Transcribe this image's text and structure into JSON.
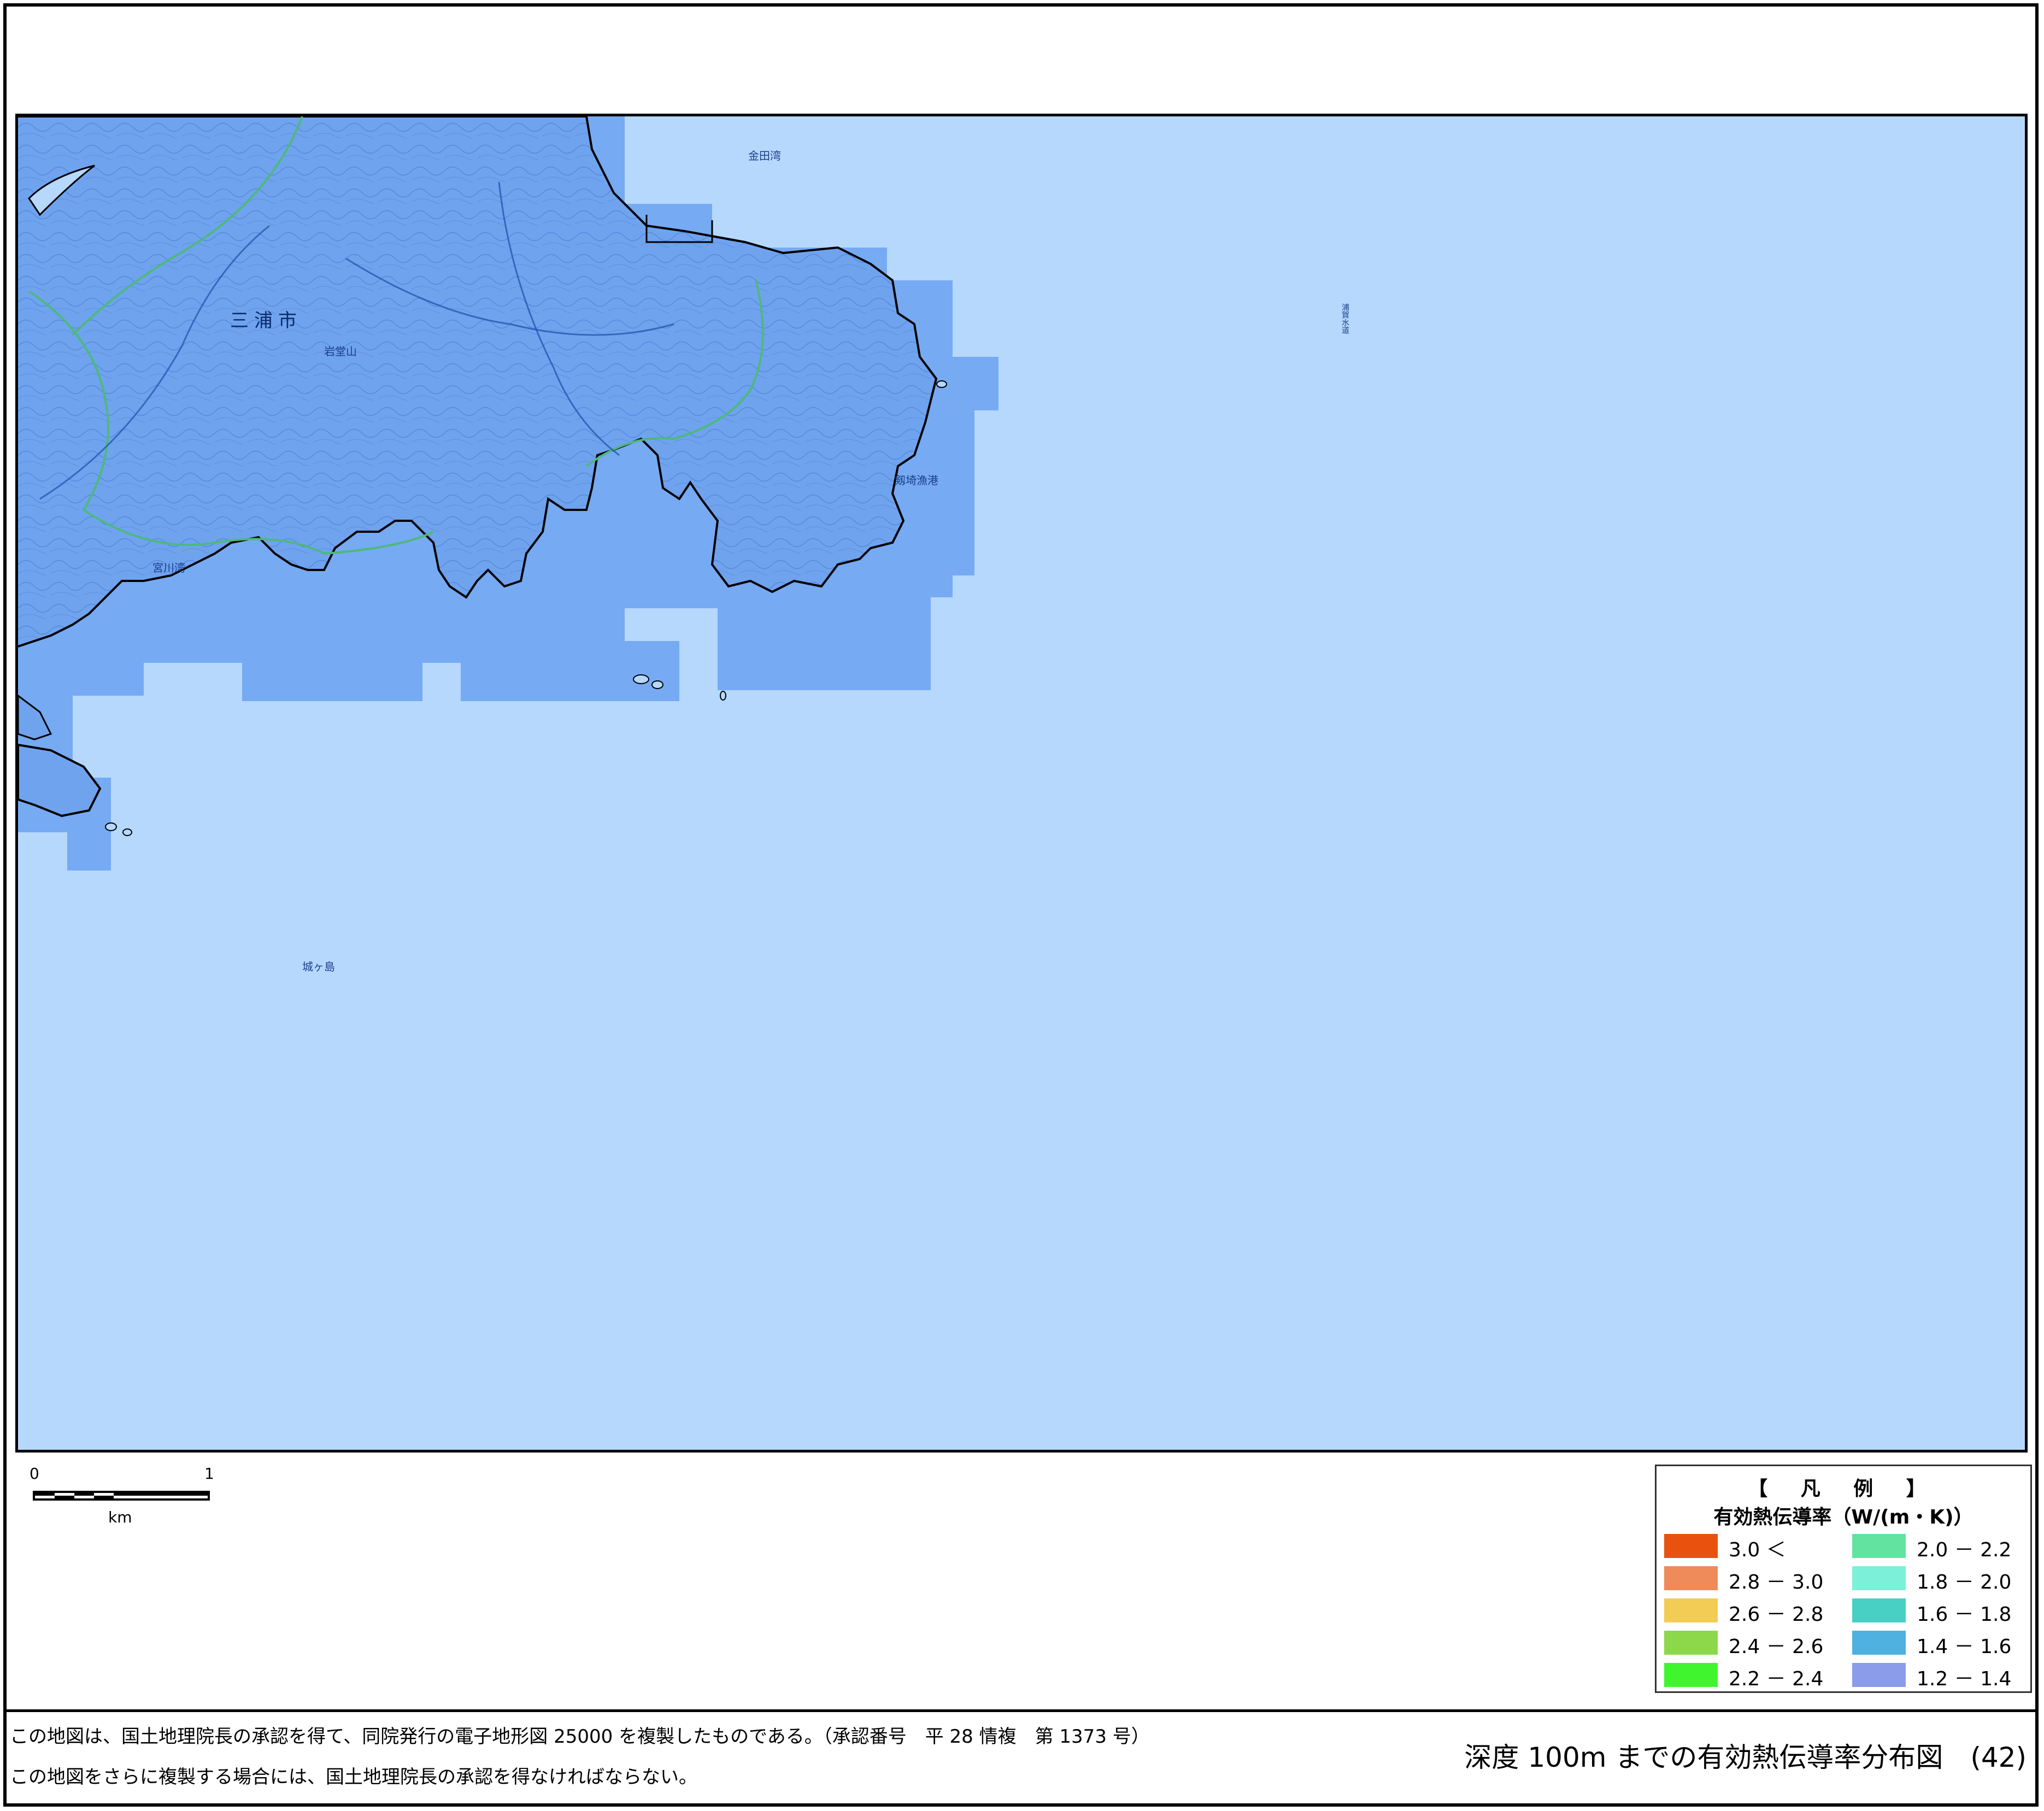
{
  "map": {
    "places": {
      "miura_city": "三浦市",
      "yamaname": "岩堂山",
      "kaneda_bay": "金田湾",
      "miyakawa_bay": "宮川湾",
      "suiro": "浦賀水道",
      "jogashima": "城ヶ島",
      "oshima_bay": "剱埼漁港"
    },
    "colors": {
      "sea": "#b5d8fc",
      "land": "#6fa3ee",
      "mesh": "#76aaf2",
      "coast": "#000000",
      "boundary": "#4fb87c"
    }
  },
  "scale": {
    "zero": "0",
    "one": "1",
    "unit": "km"
  },
  "legend": {
    "title": "【 凡 例 】",
    "subtitle": "有効熱伝導率（W/(m・K)）",
    "items": [
      {
        "label": "3.0 ＜",
        "color": "#e8520e"
      },
      {
        "label": "2.8 － 3.0",
        "color": "#ef8a5a"
      },
      {
        "label": "2.6 － 2.8",
        "color": "#f3cc55"
      },
      {
        "label": "2.4 － 2.6",
        "color": "#8cd84a"
      },
      {
        "label": "2.2 － 2.4",
        "color": "#41f52e"
      },
      {
        "label": "2.0 － 2.2",
        "color": "#62e3a0"
      },
      {
        "label": "1.8 － 2.0",
        "color": "#7cf0d8"
      },
      {
        "label": "1.6 － 1.8",
        "color": "#49d0c5"
      },
      {
        "label": "1.4 － 1.6",
        "color": "#4fb1df"
      },
      {
        "label": "1.2 － 1.4",
        "color": "#8a9cea"
      }
    ]
  },
  "footer": {
    "note1": "この地図は、国土地理院長の承認を得て、同院発行の電子地形図 25000 を複製したものである。（承認番号　平 28 情複　第 1373 号）",
    "note2": "この地図をさらに複製する場合には、国土地理院長の承認を得なければならない。",
    "title": "深度 100m までの有効熱伝導率分布図　(42)"
  }
}
